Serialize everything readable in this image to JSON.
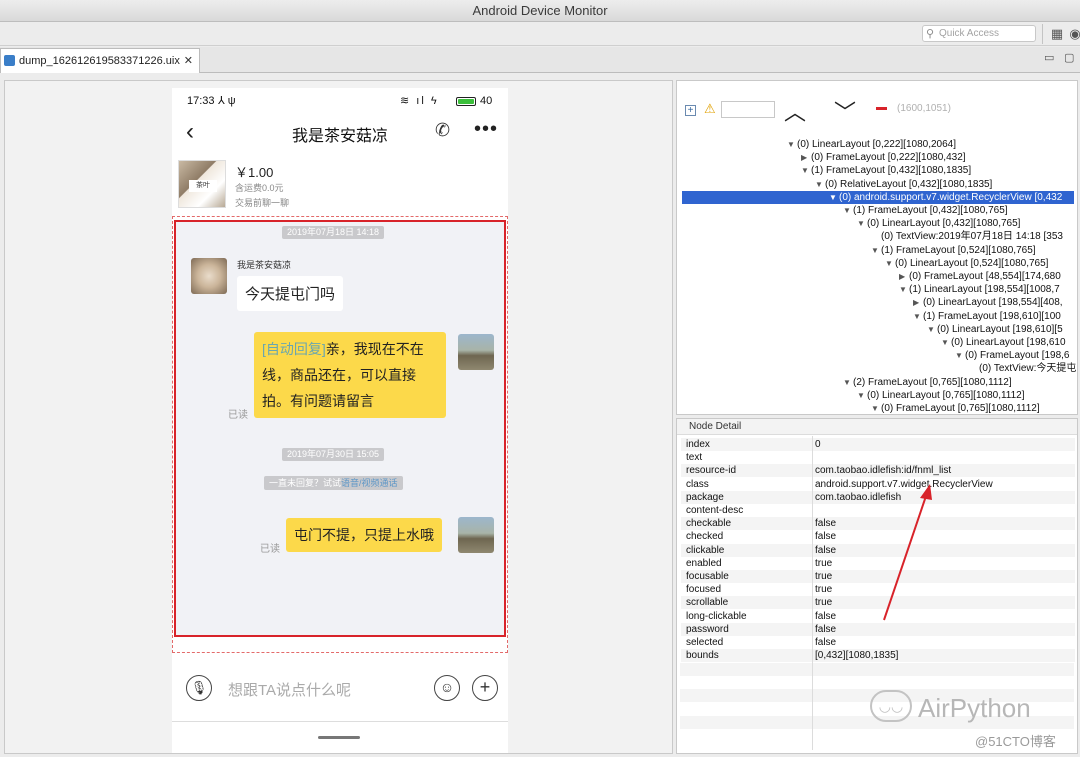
{
  "app": {
    "title": "Android Device Monitor",
    "quick_access_placeholder": "Quick Access",
    "file_tab": "dump_1626126195833712 26.uix"
  },
  "phone": {
    "status": {
      "time": "17:33",
      "battery": "40"
    },
    "header": {
      "title": "我是茶安菇凉"
    },
    "product": {
      "price": "￥1.00",
      "shipping": "含运费0.0元",
      "note": "交易前聊一聊",
      "thumb_label": "茶叶"
    },
    "chat": {
      "time1": "2019年07月18日 14:18",
      "sender_name": "我是茶安菇凉",
      "msg1": "今天提屯门吗",
      "auto_tag": "[自动回复]",
      "msg2_line1": "亲，我现在不在",
      "msg2_line2": "线，商品还在，可以直接",
      "msg2_line3": "拍。有问题请留言",
      "read1": "已读",
      "time2": "2019年07月30日 15:05",
      "hint_text": "一直未回复？试试",
      "hint_link": "语音/视频通话",
      "msg3": "屯门不提，只提上水哦",
      "read2": "已读"
    },
    "input": {
      "placeholder": "想跟TA说点什么呢"
    }
  },
  "tree": {
    "coords": "(1600,1051)",
    "rows": [
      "(0) LinearLayout [0,222][1080,2064]",
      "(0) FrameLayout [0,222][1080,432]",
      "(1) FrameLayout [0,432][1080,1835]",
      "(0) RelativeLayout [0,432][1080,1835]",
      "(0) android.support.v7.widget.RecyclerView [0,432",
      "(1) FrameLayout [0,432][1080,765]",
      "(0) LinearLayout [0,432][1080,765]",
      "(0) TextView:2019年07月18日 14:18 [353",
      "(1) FrameLayout [0,524][1080,765]",
      "(0) LinearLayout [0,524][1080,765]",
      "(0) FrameLayout [48,554][174,680",
      "(1) LinearLayout [198,554][1008,7",
      "(0) LinearLayout [198,554][408,",
      "(1) FrameLayout [198,610][100",
      "(0) LinearLayout [198,610][5",
      "(0) LinearLayout [198,610",
      "(0) FrameLayout [198,6",
      "(0) TextView:今天提屯",
      "(2) FrameLayout [0,765][1080,1112]",
      "(0) LinearLayout [0,765][1080,1112]",
      "(0) FrameLayout [0,765][1080,1112]"
    ]
  },
  "detail": {
    "header": "Node Detail",
    "keys": [
      "index",
      "text",
      "resource-id",
      "class",
      "package",
      "content-desc",
      "checkable",
      "checked",
      "clickable",
      "enabled",
      "focusable",
      "focused",
      "scrollable",
      "long-clickable",
      "password",
      "selected",
      "bounds"
    ],
    "values": [
      "0",
      "",
      "com.taobao.idlefish:id/fnml_list",
      "android.support.v7.widget.RecyclerView",
      "com.taobao.idlefish",
      "",
      "false",
      "false",
      "false",
      "true",
      "true",
      "true",
      "true",
      "false",
      "false",
      "false",
      "[0,432][1080,1835]"
    ]
  },
  "watermark": {
    "brand": "AirPython",
    "source": "@51CTO博客"
  },
  "colors": {
    "highlight_red": "#d8232a",
    "tree_selection": "#2f64d0",
    "bubble_yellow": "#fcd94a"
  }
}
